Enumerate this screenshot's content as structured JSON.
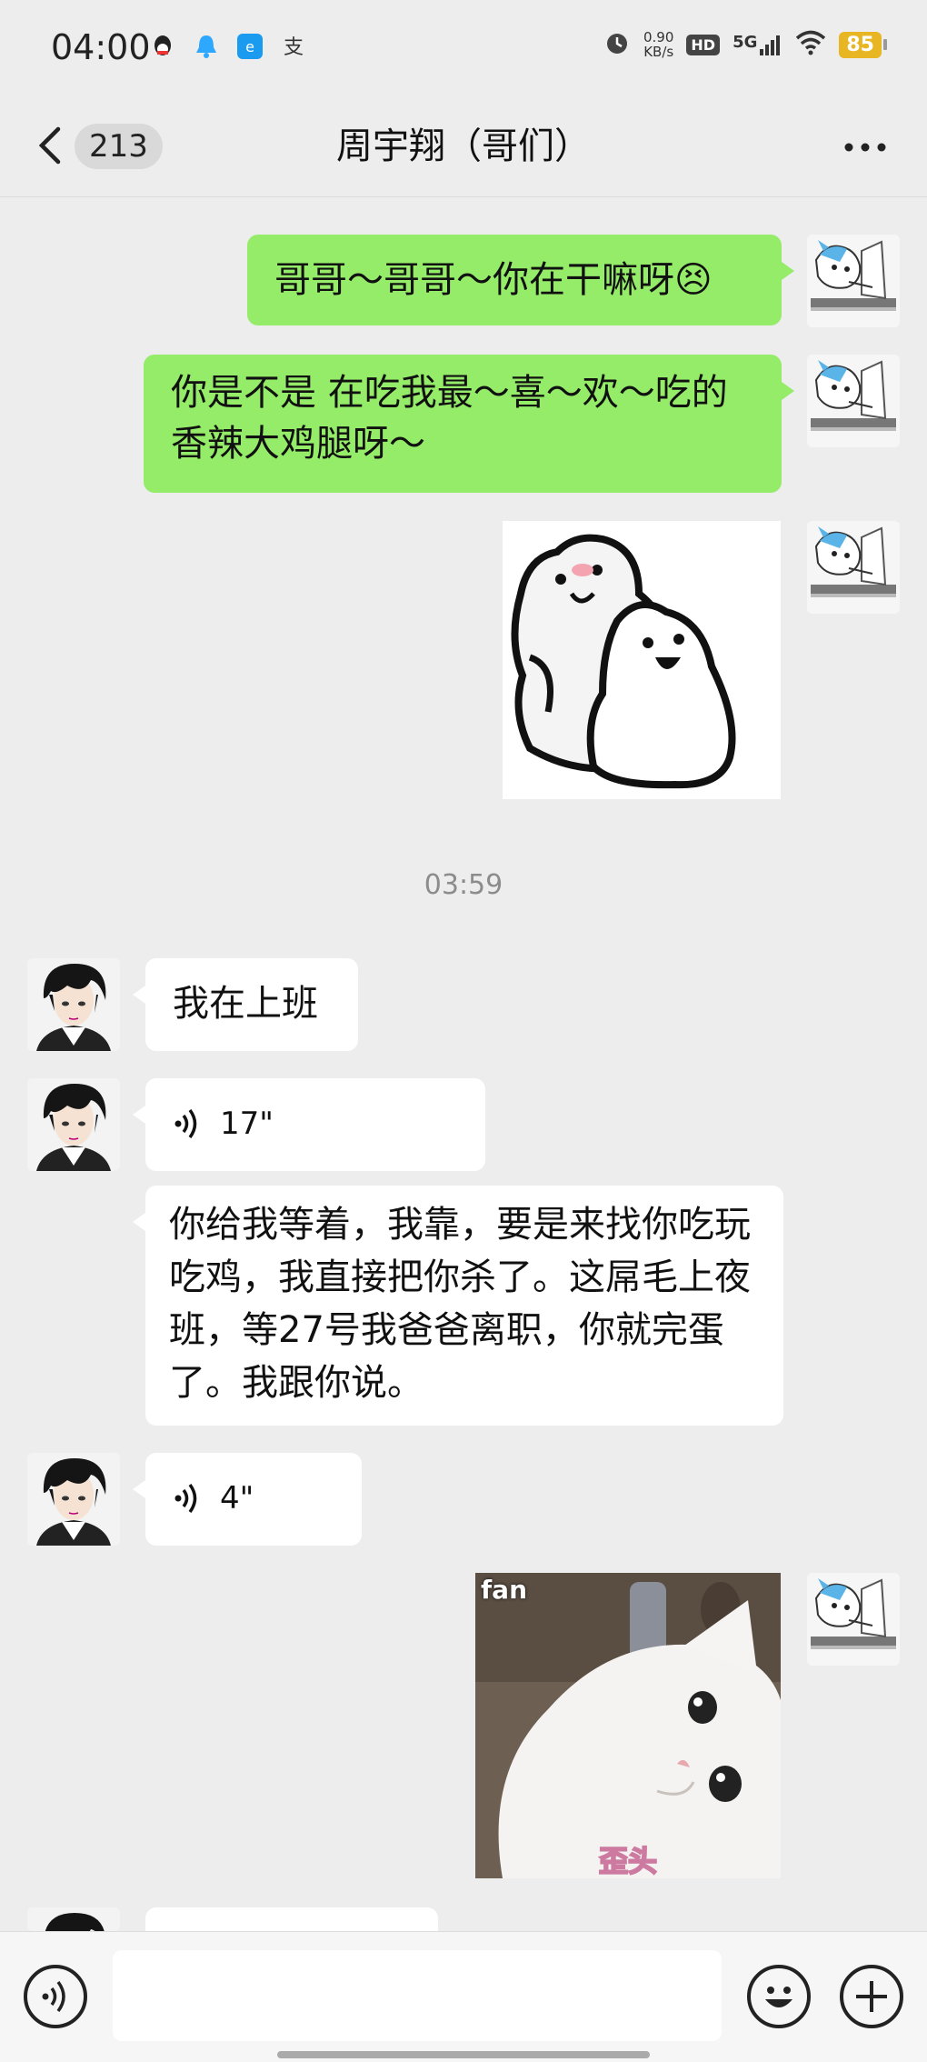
{
  "status_bar": {
    "time": "04:00",
    "speed_value": "0.90",
    "speed_unit": "KB/s",
    "hd": "HD",
    "network": "5G",
    "battery": "85"
  },
  "header": {
    "back_count": "213",
    "title": "周宇翔（哥们）"
  },
  "messages": {
    "m1": "哥哥～哥哥～你在干嘛呀😣",
    "m2": "你是不是 在吃我最～喜～欢～吃的香辣大鸡腿呀～",
    "timestamp": "03:59",
    "m3": "我在上班",
    "voice1": "17\"",
    "m4": "你给我等着，我靠，要是来找你吃玩吃鸡，我直接把你杀了。这屌毛上夜班，等27号我爸爸离职，你就完蛋了。我跟你说。",
    "voice2": "4\"",
    "cat_caption": "歪头",
    "cat_watermark": "fan"
  },
  "colors": {
    "my_bubble": "#95ec69",
    "other_bubble": "#ffffff",
    "background": "#ededed"
  }
}
